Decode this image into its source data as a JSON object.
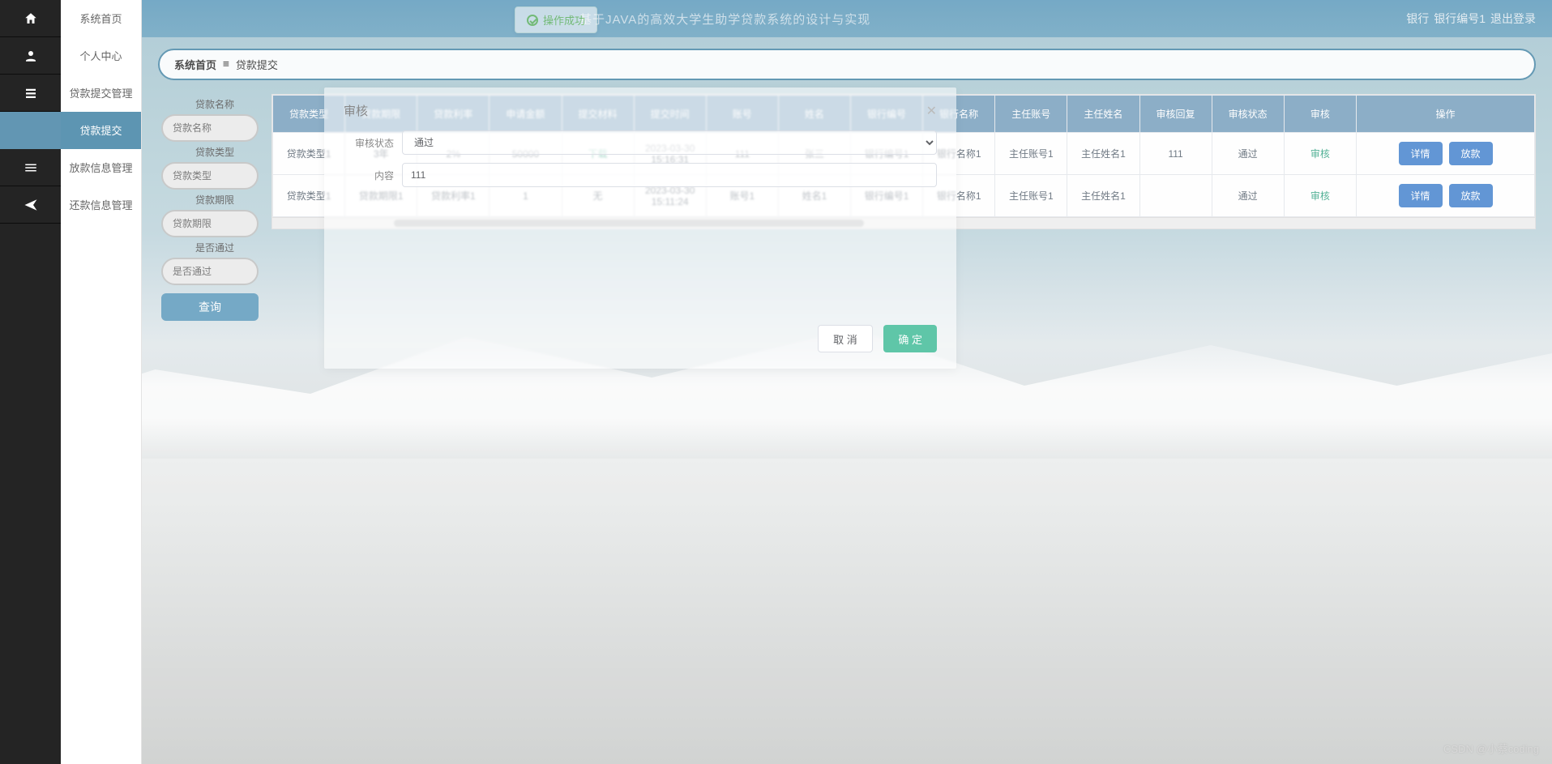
{
  "header": {
    "system_title": "基于JAVA的高效大学生助学贷款系统的设计与实现",
    "toast": "操作成功",
    "user_role": "银行",
    "user_name": "银行编号1",
    "logout": "退出登录"
  },
  "rail_tooltips": [
    "home",
    "user",
    "list",
    "submit",
    "menu",
    "send"
  ],
  "sidebar": {
    "items": [
      {
        "label": "系统首页"
      },
      {
        "label": "个人中心"
      },
      {
        "label": "贷款提交管理"
      },
      {
        "label": "贷款提交",
        "selected": true
      },
      {
        "label": "放款信息管理"
      },
      {
        "label": "还款信息管理"
      }
    ]
  },
  "breadcrumb": {
    "root": "系统首页",
    "cur": "贷款提交"
  },
  "filter": {
    "labels": {
      "name": "贷款名称",
      "type": "贷款类型",
      "period": "贷款期限",
      "pass": "是否通过"
    },
    "placeholders": {
      "name": "贷款名称",
      "type": "贷款类型",
      "period": "贷款期限",
      "pass": "是否通过"
    },
    "query_btn": "查询"
  },
  "table": {
    "headers": [
      "贷款类型",
      "贷款期限",
      "贷款利率",
      "申请金额",
      "提交材料",
      "提交时间",
      "账号",
      "姓名",
      "银行编号",
      "银行名称",
      "主任账号",
      "主任姓名",
      "审核回复",
      "审核状态",
      "审核",
      "操作"
    ],
    "rows": [
      {
        "cells": [
          "贷款类型1",
          "3年",
          "2%",
          "50000",
          "下载",
          "2023-03-30 15:16:31",
          "111",
          "张三",
          "银行编号1",
          "银行名称1",
          "主任账号1",
          "主任姓名1",
          "111",
          "通过",
          "审核"
        ],
        "detail": "详情",
        "act": "放款"
      },
      {
        "cells": [
          "贷款类型1",
          "贷款期限1",
          "贷款利率1",
          "1",
          "无",
          "2023-03-30 15:11:24",
          "账号1",
          "姓名1",
          "银行编号1",
          "银行名称1",
          "主任账号1",
          "主任姓名1",
          "",
          "通过",
          "审核"
        ],
        "detail": "详情",
        "act": "放款"
      }
    ],
    "scroll_hint": ""
  },
  "modal": {
    "title": "审核",
    "status_label": "审核状态",
    "status_value": "通过",
    "content_label": "内容",
    "content_value": "111",
    "cancel": "取 消",
    "ok": "确 定"
  },
  "watermark": "CSDN @小蔡coding"
}
